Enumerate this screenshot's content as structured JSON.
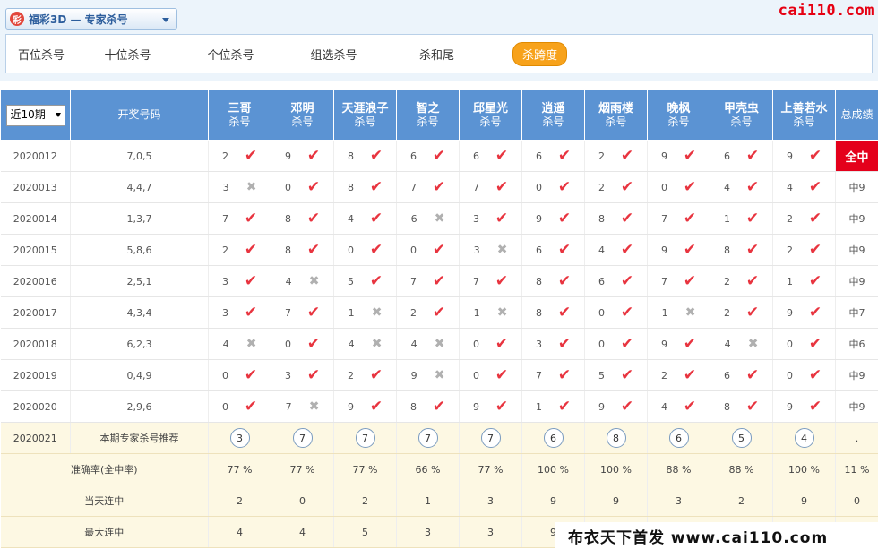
{
  "header": {
    "lottery_logo_text": "彩",
    "lottery_title": "福彩3D — 专家杀号",
    "site_logo": "cai110.com"
  },
  "tabs": [
    {
      "label": "百位杀号",
      "active": false
    },
    {
      "label": "十位杀号",
      "active": false
    },
    {
      "label": "个位杀号",
      "active": false
    },
    {
      "label": "组选杀号",
      "active": false
    },
    {
      "label": "杀和尾",
      "active": false
    },
    {
      "label": "杀跨度",
      "active": true
    }
  ],
  "table": {
    "period_select_value": "近10期",
    "col_draw": "开奖号码",
    "experts": [
      {
        "name": "三哥",
        "sub": "杀号"
      },
      {
        "name": "邓明",
        "sub": "杀号"
      },
      {
        "name": "天涯浪子",
        "sub": "杀号"
      },
      {
        "name": "智之",
        "sub": "杀号"
      },
      {
        "name": "邱星光",
        "sub": "杀号"
      },
      {
        "name": "逍遥",
        "sub": "杀号"
      },
      {
        "name": "烟雨楼",
        "sub": "杀号"
      },
      {
        "name": "晚枫",
        "sub": "杀号"
      },
      {
        "name": "甲壳虫",
        "sub": "杀号"
      },
      {
        "name": "上善若水",
        "sub": "杀号"
      }
    ],
    "col_total": "总成绩",
    "rows": [
      {
        "issue": "2020012",
        "draw": "7,0,5",
        "vals": [
          "2",
          "9",
          "8",
          "6",
          "6",
          "6",
          "2",
          "9",
          "6",
          "9"
        ],
        "hits": [
          1,
          1,
          1,
          1,
          1,
          1,
          1,
          1,
          1,
          1
        ],
        "total": "全中",
        "full": true
      },
      {
        "issue": "2020013",
        "draw": "4,4,7",
        "vals": [
          "3",
          "0",
          "8",
          "7",
          "7",
          "0",
          "2",
          "0",
          "4",
          "4"
        ],
        "hits": [
          0,
          1,
          1,
          1,
          1,
          1,
          1,
          1,
          1,
          1
        ],
        "total": "中9",
        "full": false
      },
      {
        "issue": "2020014",
        "draw": "1,3,7",
        "vals": [
          "7",
          "8",
          "4",
          "6",
          "3",
          "9",
          "8",
          "7",
          "1",
          "2"
        ],
        "hits": [
          1,
          1,
          1,
          0,
          1,
          1,
          1,
          1,
          1,
          1
        ],
        "total": "中9",
        "full": false
      },
      {
        "issue": "2020015",
        "draw": "5,8,6",
        "vals": [
          "2",
          "8",
          "0",
          "0",
          "3",
          "6",
          "4",
          "9",
          "8",
          "2"
        ],
        "hits": [
          1,
          1,
          1,
          1,
          0,
          1,
          1,
          1,
          1,
          1
        ],
        "total": "中9",
        "full": false
      },
      {
        "issue": "2020016",
        "draw": "2,5,1",
        "vals": [
          "3",
          "4",
          "5",
          "7",
          "7",
          "8",
          "6",
          "7",
          "2",
          "1"
        ],
        "hits": [
          1,
          0,
          1,
          1,
          1,
          1,
          1,
          1,
          1,
          1
        ],
        "total": "中9",
        "full": false
      },
      {
        "issue": "2020017",
        "draw": "4,3,4",
        "vals": [
          "3",
          "7",
          "1",
          "2",
          "1",
          "8",
          "0",
          "1",
          "2",
          "9"
        ],
        "hits": [
          1,
          1,
          0,
          1,
          0,
          1,
          1,
          0,
          1,
          1
        ],
        "total": "中7",
        "full": false
      },
      {
        "issue": "2020018",
        "draw": "6,2,3",
        "vals": [
          "4",
          "0",
          "4",
          "4",
          "0",
          "3",
          "0",
          "9",
          "4",
          "0"
        ],
        "hits": [
          0,
          1,
          0,
          0,
          1,
          1,
          1,
          1,
          0,
          1
        ],
        "total": "中6",
        "full": false
      },
      {
        "issue": "2020019",
        "draw": "0,4,9",
        "vals": [
          "0",
          "3",
          "2",
          "9",
          "0",
          "7",
          "5",
          "2",
          "6",
          "0"
        ],
        "hits": [
          1,
          1,
          1,
          0,
          1,
          1,
          1,
          1,
          1,
          1
        ],
        "total": "中9",
        "full": false
      },
      {
        "issue": "2020020",
        "draw": "2,9,6",
        "vals": [
          "0",
          "7",
          "9",
          "8",
          "9",
          "1",
          "9",
          "4",
          "8",
          "9"
        ],
        "hits": [
          1,
          0,
          1,
          1,
          1,
          1,
          1,
          1,
          1,
          1
        ],
        "total": "中9",
        "full": false
      }
    ],
    "recommend": {
      "issue": "2020021",
      "label": "本期专家杀号推荐",
      "vals": [
        "3",
        "7",
        "7",
        "7",
        "7",
        "6",
        "8",
        "6",
        "5",
        "4"
      ],
      "total": "."
    },
    "accuracy": {
      "label": "准确率(全中率)",
      "vals": [
        "77 %",
        "77 %",
        "77 %",
        "66 %",
        "77 %",
        "100 %",
        "100 %",
        "88 %",
        "88 %",
        "100 %"
      ],
      "total": "11 %"
    },
    "today_streak": {
      "label": "当天连中",
      "vals": [
        "2",
        "0",
        "2",
        "1",
        "3",
        "9",
        "9",
        "3",
        "2",
        "9"
      ],
      "total": "0"
    },
    "max_streak": {
      "label": "最大连中",
      "vals": [
        "4",
        "4",
        "5",
        "3",
        "3",
        "9",
        "",
        "",
        "",
        ""
      ],
      "total": ""
    }
  },
  "watermark": "布衣天下首发 www.cai110.com"
}
